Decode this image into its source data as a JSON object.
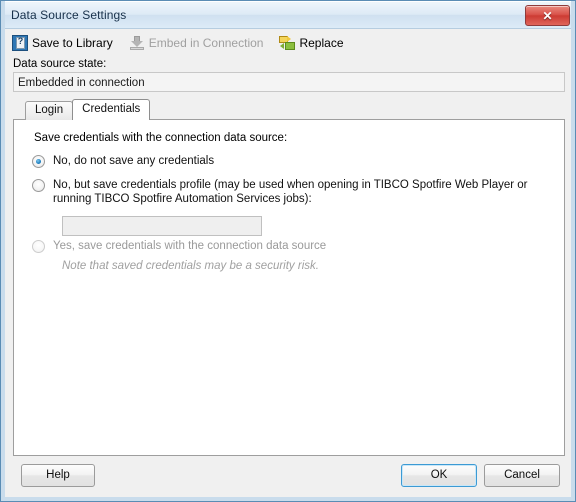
{
  "window": {
    "title": "Data Source Settings",
    "close_label": "✕",
    "close_icon": "close-icon"
  },
  "toolbar": {
    "items": [
      {
        "label": "Save to Library",
        "icon": "library-icon",
        "enabled": true
      },
      {
        "label": "Embed in Connection",
        "icon": "download-icon",
        "enabled": false
      },
      {
        "label": "Replace",
        "icon": "replace-icon",
        "enabled": true
      }
    ]
  },
  "state": {
    "label": "Data source state:",
    "value": "Embedded in connection"
  },
  "tabs": [
    {
      "label": "Login",
      "active": false
    },
    {
      "label": "Credentials",
      "active": true
    }
  ],
  "credentials": {
    "group_label": "Save credentials with the connection data source:",
    "options": [
      {
        "label": "No, do not save any credentials",
        "selected": true,
        "enabled": true
      },
      {
        "label": "No, but save credentials profile (may be used when opening in TIBCO Spotfire Web Player or running TIBCO Spotfire Automation Services jobs):",
        "selected": false,
        "enabled": true
      },
      {
        "label": "Yes, save credentials with the connection data source",
        "selected": false,
        "enabled": false
      }
    ],
    "profile_input": {
      "value": "",
      "placeholder": ""
    },
    "note": "Note that saved credentials may be a security risk."
  },
  "buttons": {
    "help": "Help",
    "ok": "OK",
    "cancel": "Cancel"
  },
  "colors": {
    "accent": "#3c9ad4",
    "title_bar": "#dceaf6",
    "close_red": "#cc3b33",
    "radio_dot": "#1f7fc0",
    "disabled_text": "#9a9a9a"
  }
}
